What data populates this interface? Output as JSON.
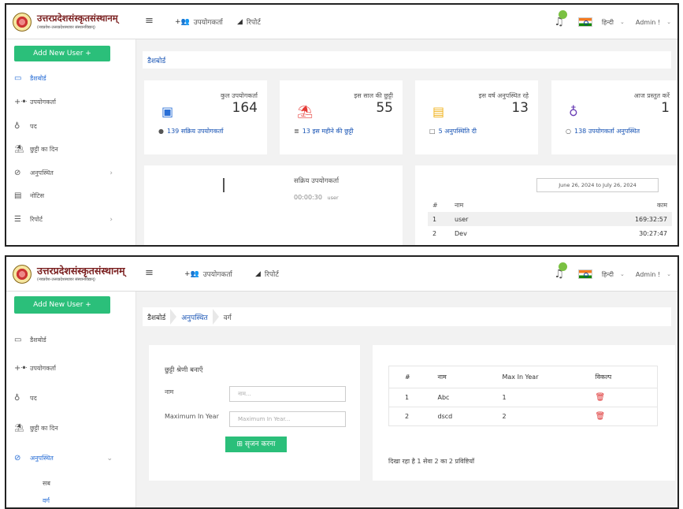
{
  "brand": {
    "title": "उत्तरप्रदेशसंस्कृतसंस्थानम्",
    "subtitle_1": "(नवप्रवेश-उत्तरप्रदेशस्थावर संस्थानविद्यान्)",
    "subtitle_2": "(नवप्रवेश-उत्तरप्रदेशस्थावर संस्थानविद्यान्)"
  },
  "topnav": {
    "users": "उपयोगकर्ता",
    "reports": "रिपोर्ट",
    "notifications_count": "",
    "language": "हिन्दी",
    "admin": "Admin !"
  },
  "sidebar": {
    "add_user": "Add New User +",
    "items_1": [
      {
        "label": "डैशबोर्ड",
        "icon": "monitor-icon"
      },
      {
        "label": "उपयोगकर्ता",
        "icon": "users-icon"
      },
      {
        "label": "पद",
        "icon": "sitemap-icon"
      },
      {
        "label": "छुट्टी का दिन",
        "icon": "umbrella-icon"
      },
      {
        "label": "अनुपस्थित",
        "icon": "absent-icon"
      },
      {
        "label": "नोटिस",
        "icon": "notice-icon"
      },
      {
        "label": "रिपोर्ट",
        "icon": "report-icon"
      }
    ],
    "items_2": [
      {
        "label": "डैशबोर्ड"
      },
      {
        "label": "उपयोगकर्ता"
      },
      {
        "label": "पद"
      },
      {
        "label": "छुट्टी का दिन"
      },
      {
        "label": "अनुपस्थित"
      }
    ],
    "submenu": [
      "सब",
      "वर्ग"
    ]
  },
  "dashboard": {
    "breadcrumb": "डैशबोर्ड",
    "stats": [
      {
        "title": "कुल उपयोगकर्ता",
        "value": "164",
        "footer_count": "139",
        "footer": "सक्रिय उपयोगकर्ता",
        "icon": "id-card-icon",
        "color": "#2a6fd6"
      },
      {
        "title": "इस साल की छुट्टी",
        "value": "55",
        "footer_count": "13",
        "footer": "इस महीने की छुट्टी",
        "icon": "beach-umbrella-icon",
        "color": "#e53935"
      },
      {
        "title": "इस वर्ष अनुपस्थित रहे",
        "value": "13",
        "footer_count": "5",
        "footer": "अनुपस्थिति दी",
        "icon": "list-icon",
        "color": "#f0b21a"
      },
      {
        "title": "आज प्रस्तुत करें",
        "value": "1",
        "footer_count": "138",
        "footer": "उपयोगकर्ता अनुपस्थित",
        "icon": "sitemap-icon",
        "color": "#6a3fb5"
      }
    ],
    "active_users": {
      "title": "सक्रिय उपयोगकर्ता",
      "time": "00:00:30",
      "user": "user"
    },
    "date_range": "June 26, 2024 to July 26, 2024",
    "table": {
      "headers": [
        "#",
        "नाम",
        "काम"
      ],
      "rows": [
        [
          "1",
          "user",
          "169:32:57"
        ],
        [
          "2",
          "Dev",
          "30:27:47"
        ]
      ]
    }
  },
  "category": {
    "breadcrumb": [
      "डैशबोर्ड",
      "अनुपस्थित",
      "वर्ग"
    ],
    "form_title": "छुट्टी श्रेणी बनाएँ",
    "name_label": "नाम",
    "name_placeholder": "नाम...",
    "max_label": "Maximum In Year",
    "max_placeholder": "Maximum In Year...",
    "create_button": "⊞ सृजन करना",
    "table": {
      "headers": [
        "#",
        "नाम",
        "Max In Year",
        "विकल्प"
      ],
      "rows": [
        [
          "1",
          "Abc",
          "1"
        ],
        [
          "2",
          "dscd",
          "2"
        ]
      ]
    },
    "showing": "दिखा रहा है 1 सेवा 2 का 2 प्रविष्टियाँ"
  }
}
